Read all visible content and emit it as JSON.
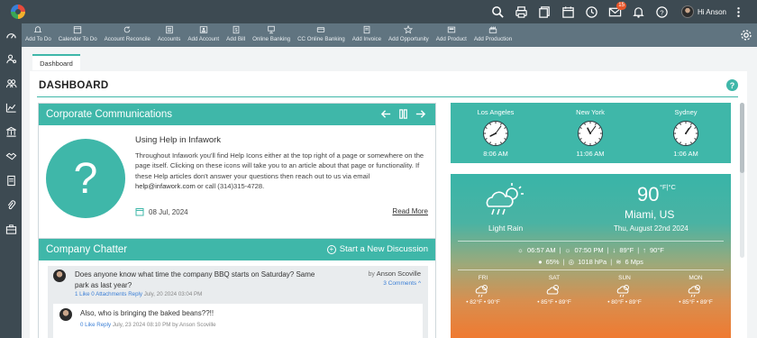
{
  "top_bar": {
    "user_greeting": "Hi Anson",
    "mail_badge": "15",
    "icons": [
      "search-icon",
      "print-icon",
      "copy-icon",
      "calendar-icon",
      "clock-icon",
      "mail-icon",
      "bell-icon",
      "help-icon",
      "more-icon"
    ]
  },
  "toolbar": {
    "items": [
      {
        "label": "Add To Do",
        "icon": "bell-icon"
      },
      {
        "label": "Calender To Do",
        "icon": "calendar-icon"
      },
      {
        "label": "Account Reconcile",
        "icon": "refresh-icon"
      },
      {
        "label": "Accounts",
        "icon": "list-icon"
      },
      {
        "label": "Add Account",
        "icon": "user-add-icon"
      },
      {
        "label": "Add Bill",
        "icon": "bill-icon"
      },
      {
        "label": "Online Banking",
        "icon": "bank-icon"
      },
      {
        "label": "CC Online Banking",
        "icon": "card-icon"
      },
      {
        "label": "Add Invoice",
        "icon": "invoice-icon"
      },
      {
        "label": "Add Opportunity",
        "icon": "star-icon"
      },
      {
        "label": "Add Product",
        "icon": "product-icon"
      },
      {
        "label": "Add Production",
        "icon": "production-icon"
      }
    ]
  },
  "tabs": {
    "active": "Dashboard"
  },
  "dashboard": {
    "title": "DASHBOARD"
  },
  "corporate": {
    "header": "Corporate Communications",
    "title": "Using Help in Infawork",
    "body_1": "Throughout Infawork you'll find Help Icons either at the top right of a page or somewhere on the page itself. Clicking on these icons will take you to an article about that page or functionality. If these Help articles don't answer your questions then reach out to us via email ",
    "email": "help@infawork.com",
    "body_2": " or call (314)315-4728.",
    "date": "08 Jul, 2024",
    "read_more": "Read More"
  },
  "chatter": {
    "header": "Company Chatter",
    "action": "Start a New Discussion",
    "post": {
      "question": "Does anyone know what time the company BBQ starts on Saturday? Same park as last year?",
      "by_label": "by",
      "author": "Anson Scoville",
      "comments": "3 Comments ^",
      "likes": "1 Like",
      "attachments": "0 Attachments",
      "reply": "Reply",
      "date": "July, 20 2024 03:04 PM"
    },
    "reply_post": {
      "text": "Also, who is bringing the baked beans??!!",
      "likes": "0 Like",
      "reply": "Reply",
      "meta": "July, 23 2024 08:10 PM  by  Anson Scoville"
    }
  },
  "clocks": [
    {
      "city": "Los Angeles",
      "time": "8:06 AM",
      "hour": 8,
      "minute": 6
    },
    {
      "city": "New York",
      "time": "11:06 AM",
      "hour": 11,
      "minute": 6
    },
    {
      "city": "Sydney",
      "time": "1:06 AM",
      "hour": 1,
      "minute": 6
    }
  ],
  "weather": {
    "condition": "Light Rain",
    "temp": "90",
    "units": "°F|°C",
    "city": "Miami, US",
    "date": "Thu, August 22nd 2024",
    "sunrise": "06:57 AM",
    "sunset": "07:50 PM",
    "low": "89°F",
    "high": "90°F",
    "humidity": "65%",
    "pressure": "1018 hPa",
    "wind": "6 Mps",
    "forecast": [
      {
        "day": "FRI",
        "low": "82°F",
        "high": "90°F"
      },
      {
        "day": "SAT",
        "low": "85°F",
        "high": "89°F"
      },
      {
        "day": "SUN",
        "low": "80°F",
        "high": "89°F"
      },
      {
        "day": "MON",
        "low": "85°F",
        "high": "89°F"
      }
    ]
  },
  "colors": {
    "accent": "#3fb7a9",
    "topbar": "#3d4a52",
    "toolbar": "#607480",
    "badge": "#e8562a"
  }
}
